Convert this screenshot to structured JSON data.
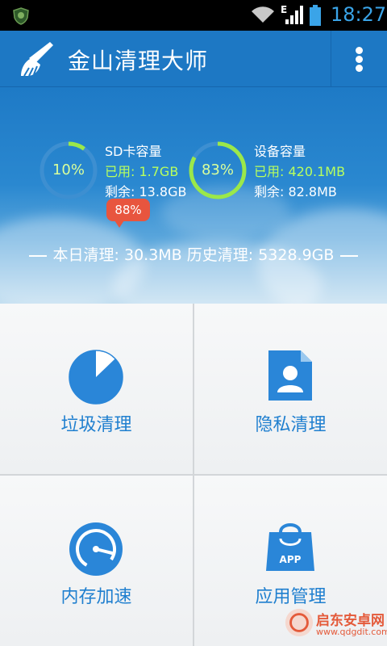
{
  "status_bar": {
    "time": "18:27",
    "network_type": "E",
    "icons": [
      "app-shield-icon",
      "wifi-icon",
      "signal-icon",
      "battery-icon"
    ]
  },
  "header": {
    "title": "金山清理大师",
    "logo_icon": "broom-icon",
    "menu_icon": "overflow-menu-icon"
  },
  "storage": {
    "sd": {
      "percent_label": "10%",
      "percent": 10,
      "title": "SD卡容量",
      "used": "已用: 1.7GB",
      "free": "剩余: 13.8GB"
    },
    "device": {
      "percent_label": "83%",
      "percent": 83,
      "title": "设备容量",
      "used": "已用: 420.1MB",
      "free": "剩余: 82.8MB"
    }
  },
  "summary": {
    "text": "本日清理: 30.3MB 历史清理: 5328.9GB"
  },
  "tiles": [
    {
      "label": "垃圾清理",
      "icon": "pie-chart-icon"
    },
    {
      "label": "隐私清理",
      "icon": "contact-file-icon"
    },
    {
      "label": "内存加速",
      "icon": "speedometer-icon",
      "badge": "88%"
    },
    {
      "label": "应用管理",
      "icon": "app-bag-icon",
      "icon_text": "APP"
    }
  ],
  "watermark": {
    "text": "启东安卓网",
    "url": "www.qdgdit.com"
  },
  "colors": {
    "primary_blue": "#1d78c4",
    "accent_green": "#b8ff5e",
    "tile_text": "#1f7fcf",
    "badge_red": "#e8553e"
  }
}
